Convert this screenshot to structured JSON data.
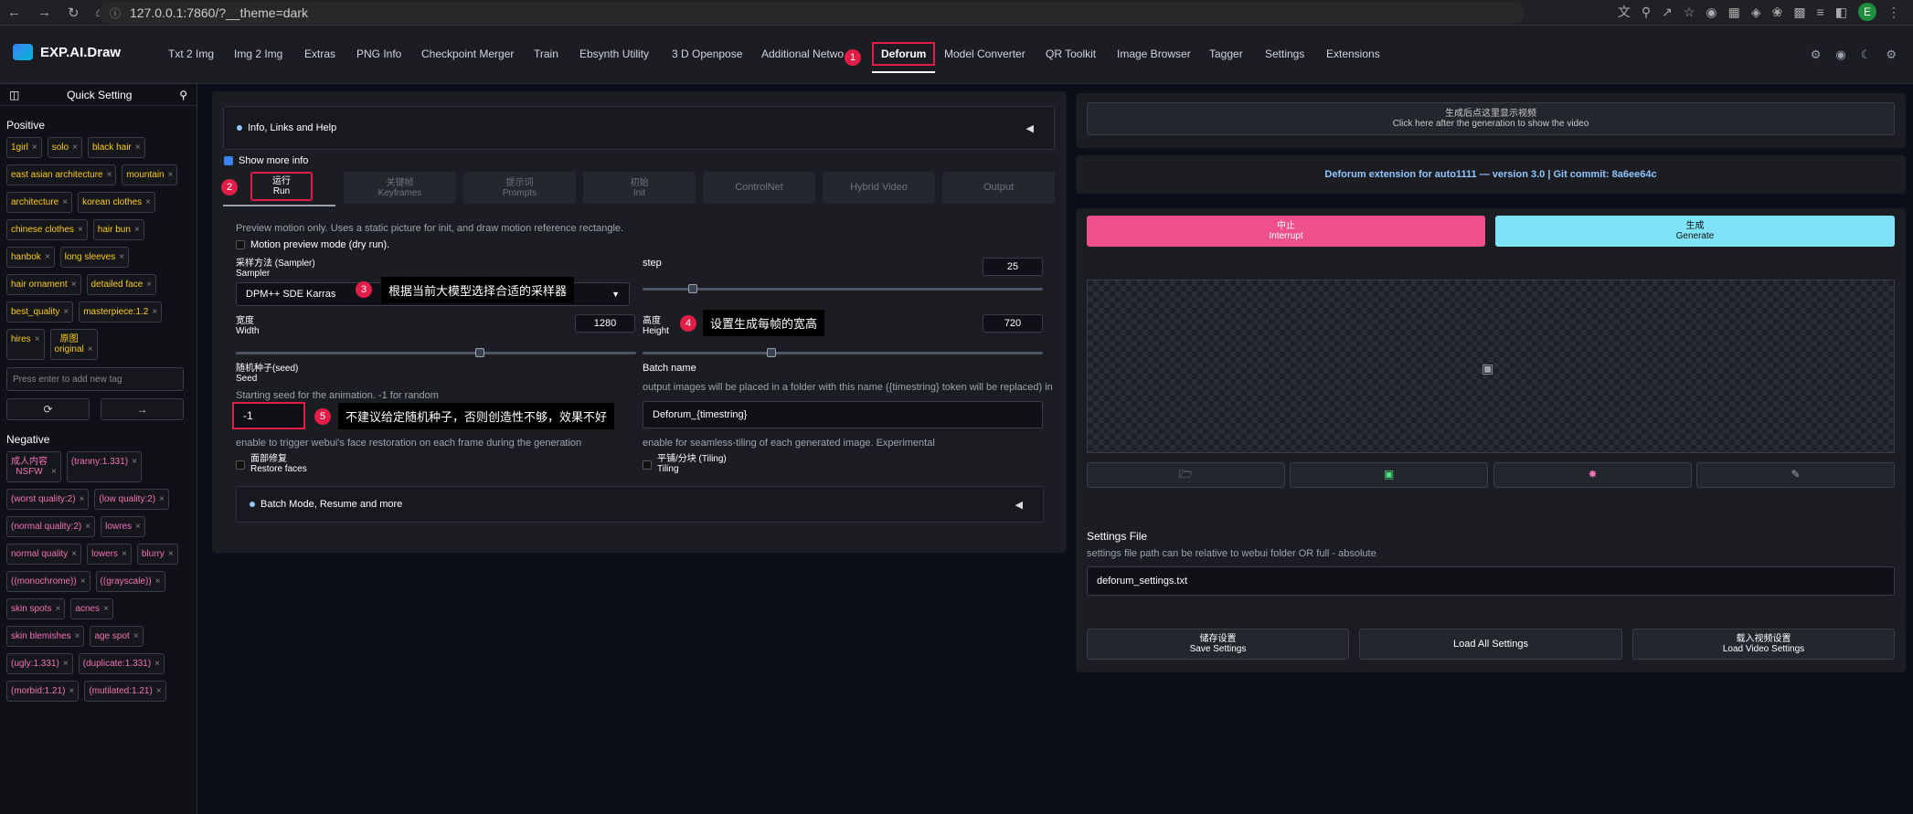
{
  "browser": {
    "url": "127.0.0.1:7860/?__theme=dark",
    "profile_initial": "E"
  },
  "app": {
    "name": "EXP.AI.Draw",
    "nav_tabs": [
      "Txt 2 Img",
      "Img 2 Img",
      "Extras",
      "PNG Info",
      "Checkpoint Merger",
      "Train",
      "Ebsynth Utility",
      "3 D Openpose",
      "Additional Netwo",
      "Deforum",
      "Model Converter",
      "QR Toolkit",
      "Image Browser",
      "Tagger",
      "Settings",
      "Extensions"
    ],
    "active_tab": "Deforum"
  },
  "sidebar": {
    "title": "Quick Setting",
    "positive_label": "Positive",
    "positive_tags": [
      [
        "1girl"
      ],
      [
        "solo"
      ],
      [
        "black hair"
      ],
      [
        "east asian architecture"
      ],
      [
        "mountain"
      ],
      [
        "architecture"
      ],
      [
        "korean clothes"
      ],
      [
        "chinese clothes"
      ],
      [
        "hair bun"
      ],
      [
        "hanbok"
      ],
      [
        "long sleeves"
      ],
      [
        "hair ornament"
      ],
      [
        "detailed face"
      ],
      [
        "best_quality"
      ],
      [
        "masterpiece:1.2"
      ],
      [
        "hires"
      ],
      [
        "原图",
        "original"
      ]
    ],
    "add_tag_placeholder": "Press enter to add new tag",
    "negative_label": "Negative",
    "negative_tags": [
      [
        "成人内容",
        "NSFW"
      ],
      [
        "(tranny:1.331)"
      ],
      [
        "(worst quality:2)"
      ],
      [
        "(low quality:2)"
      ],
      [
        "(normal quality:2)"
      ],
      [
        "lowres"
      ],
      [
        "normal quality"
      ],
      [
        "lowers"
      ],
      [
        "blurry"
      ],
      [
        "((monochrome))"
      ],
      [
        "((grayscale))"
      ],
      [
        "skin spots"
      ],
      [
        "acnes"
      ],
      [
        "skin blemishes"
      ],
      [
        "age spot"
      ],
      [
        "(ugly:1.331)"
      ],
      [
        "(duplicate:1.331)"
      ],
      [
        "(morbid:1.21)"
      ],
      [
        "(mutilated:1.21)"
      ]
    ]
  },
  "deforum": {
    "info_accordion": "Info, Links and Help",
    "show_more_info": "Show more info",
    "subtabs": [
      {
        "zh": "运行",
        "en": "Run"
      },
      {
        "zh": "关键帧",
        "en": "Keyframes"
      },
      {
        "zh": "提示词",
        "en": "Prompts"
      },
      {
        "zh": "初始",
        "en": "Init"
      },
      {
        "zh": "",
        "en": "ControlNet"
      },
      {
        "zh": "",
        "en": "Hybrid Video"
      },
      {
        "zh": "",
        "en": "Output"
      }
    ],
    "preview_desc": "Preview motion only. Uses a static picture for init, and draw motion reference rectangle.",
    "motion_preview": "Motion preview mode (dry run).",
    "sampler_zh": "采样方法 (Sampler)",
    "sampler_en": "Sampler",
    "sampler_value": "DPM++ SDE Karras",
    "step_label": "step",
    "step_value": "25",
    "width_zh": "宽度",
    "width_en": "Width",
    "width_value": "1280",
    "height_zh": "高度",
    "height_en": "Height",
    "height_value": "720",
    "seed_zh": "随机种子(seed)",
    "seed_en": "Seed",
    "seed_desc": "Starting seed for the animation. -1 for random",
    "seed_value": "-1",
    "batch_name_label": "Batch name",
    "batch_name_desc": "output images will be placed in a folder with this name ({timestring} token will be replaced) in",
    "batch_name_value": "Deforum_{timestring}",
    "restore_desc": "enable to trigger webui's face restoration on each frame during the generation",
    "restore_zh": "面部修复",
    "restore_en": "Restore faces",
    "tiling_desc": "enable for seamless-tiling of each generated image. Experimental",
    "tiling_zh": "平铺/分块 (Tiling)",
    "tiling_en": "Tiling",
    "batch_accordion": "Batch Mode, Resume and more"
  },
  "annotations": [
    {
      "n": "1"
    },
    {
      "n": "2"
    },
    {
      "n": "3",
      "text": "根据当前大模型选择合适的采样器"
    },
    {
      "n": "4",
      "text": "设置生成每帧的宽高"
    },
    {
      "n": "5",
      "text": "不建议给定随机种子，否则创造性不够，效果不好"
    }
  ],
  "right": {
    "video_hint_zh": "生成后点这里显示视频",
    "video_hint_en": "Click here after the generation to show the video",
    "version_text": "Deforum extension for auto1111 — version 3.0 | Git commit: 8a6ee64c",
    "interrupt_zh": "中止",
    "interrupt_en": "Interrupt",
    "generate_zh": "生成",
    "generate_en": "Generate",
    "settings_file_title": "Settings File",
    "settings_file_desc": "settings file path can be relative to webui folder OR full - absolute",
    "settings_file_value": "deforum_settings.txt",
    "save_zh": "储存设置",
    "save_en": "Save Settings",
    "load_all": "Load All Settings",
    "load_video_zh": "载入视频设置",
    "load_video_en": "Load Video Settings"
  },
  "colors": {
    "interrupt": "#f0508a",
    "generate": "#7fe3f7",
    "annotation": "#e11d48",
    "version_text": "#93c5fd"
  }
}
